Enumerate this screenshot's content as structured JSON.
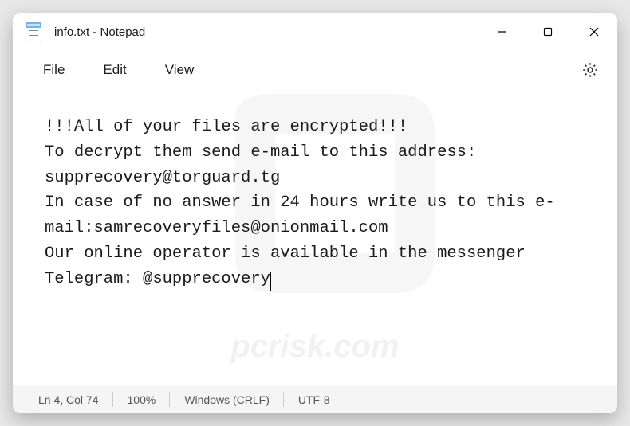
{
  "title": "info.txt - Notepad",
  "menu": {
    "file": "File",
    "edit": "Edit",
    "view": "View"
  },
  "content": "!!!All of your files are encrypted!!!\nTo decrypt them send e-mail to this address: supprecovery@torguard.tg\nIn case of no answer in 24 hours write us to this e-mail:samrecoveryfiles@onionmail.com\nOur online operator is available in the messenger Telegram: @supprecovery",
  "status": {
    "position": "Ln 4, Col 74",
    "zoom": "100%",
    "line_ending": "Windows (CRLF)",
    "encoding": "UTF-8"
  }
}
